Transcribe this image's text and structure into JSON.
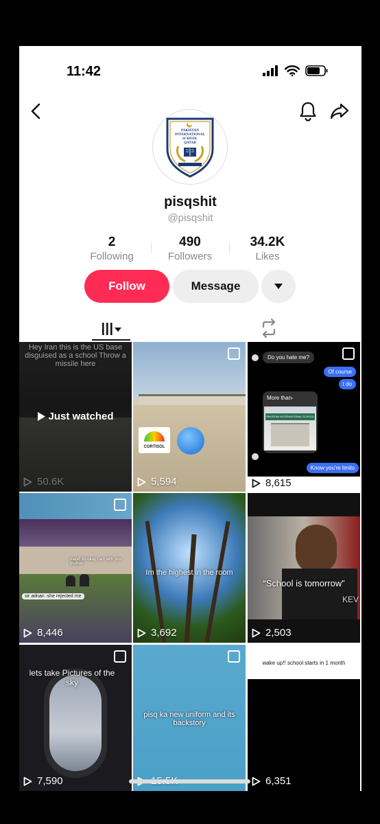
{
  "status": {
    "time": "11:42"
  },
  "profile": {
    "username": "pisqshit",
    "handle": "@pisqshit",
    "logo_text": "PAKISTAN INTERNATIONAL SCHOOL QATAR",
    "stats": [
      {
        "value": "2",
        "label": "Following"
      },
      {
        "value": "490",
        "label": "Followers"
      },
      {
        "value": "34.2K",
        "label": "Likes"
      }
    ]
  },
  "actions": {
    "follow": "Follow",
    "message": "Message"
  },
  "videos": [
    {
      "views": "50.6K",
      "caption": "Hey Iran this is the US base disguised as a school Throw a missile here",
      "overlay": "Just watched"
    },
    {
      "views": "5,594",
      "caption": "CORTISOL"
    },
    {
      "views": "8,615",
      "chat": [
        "Do you hate me?",
        "Of course",
        "I do",
        "More than-",
        "Know you're limits"
      ],
      "sign": "PAKISTAN INTERNATIONAL SCHOOL"
    },
    {
      "views": "8,446",
      "caption": "majid: its okay i am with you brother",
      "caption2": "sir adnan :she rejected me"
    },
    {
      "views": "3,692",
      "caption": "Im the highest in the room"
    },
    {
      "views": "2,503",
      "caption": "“School is tomorrow”",
      "jersey": "KEV"
    },
    {
      "views": "7,590",
      "caption": "lets take Pictures of the sky"
    },
    {
      "views": "15.5K",
      "caption": "pisq ka new uniform and its backstory"
    },
    {
      "views": "6,351",
      "caption": "wake up!! school starts in 1 month"
    }
  ],
  "colors": {
    "follow": "#fe2c55",
    "chat_blue": "#3b6ff5"
  }
}
